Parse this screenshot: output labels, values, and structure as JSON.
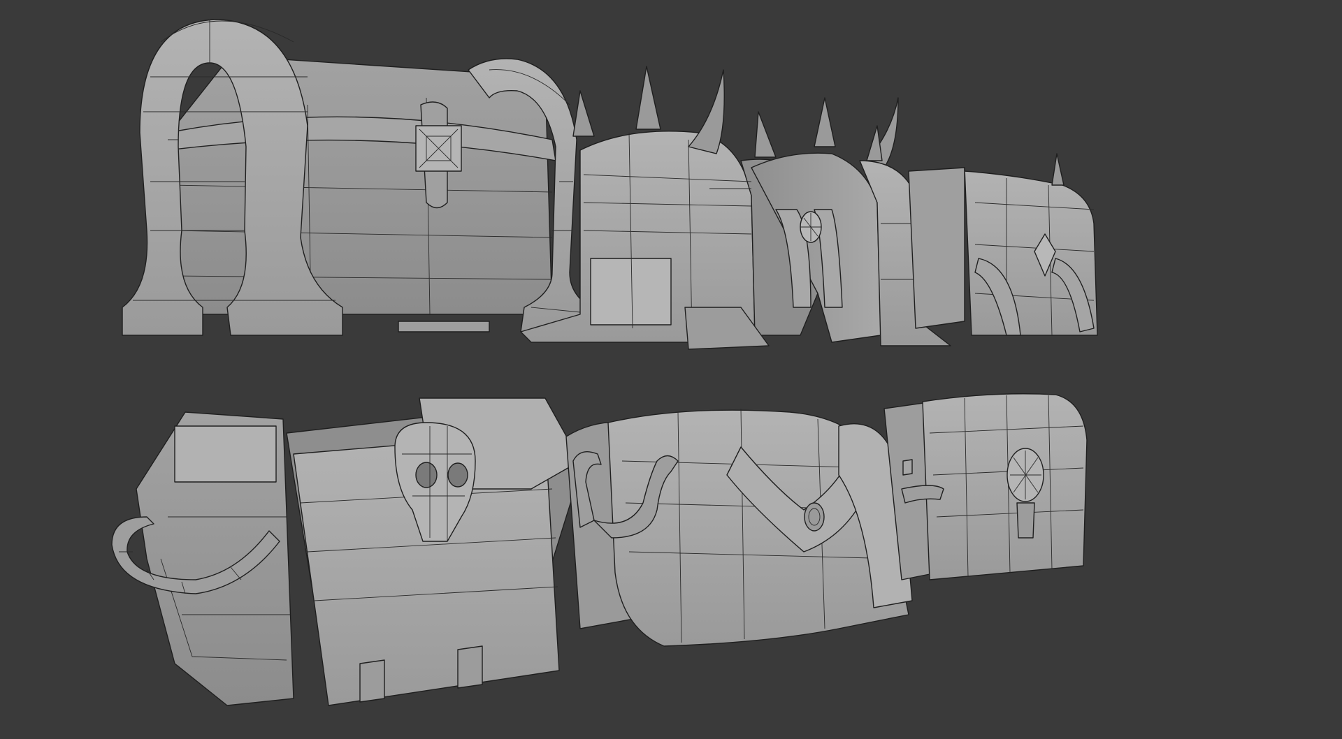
{
  "scene": {
    "background_color": "#3a3a3a",
    "mesh_color": "#a8a8a8",
    "wire_color": "#2a2a2a",
    "shading": "solid-wireframe-overlay",
    "rows": [
      {
        "row": "top",
        "models": [
          "arched-chest",
          "spiked-chest",
          "ornate-chest"
        ]
      },
      {
        "row": "bottom",
        "models": [
          "skull-chest",
          "handled-chest",
          "small-lock-chest"
        ]
      }
    ]
  }
}
